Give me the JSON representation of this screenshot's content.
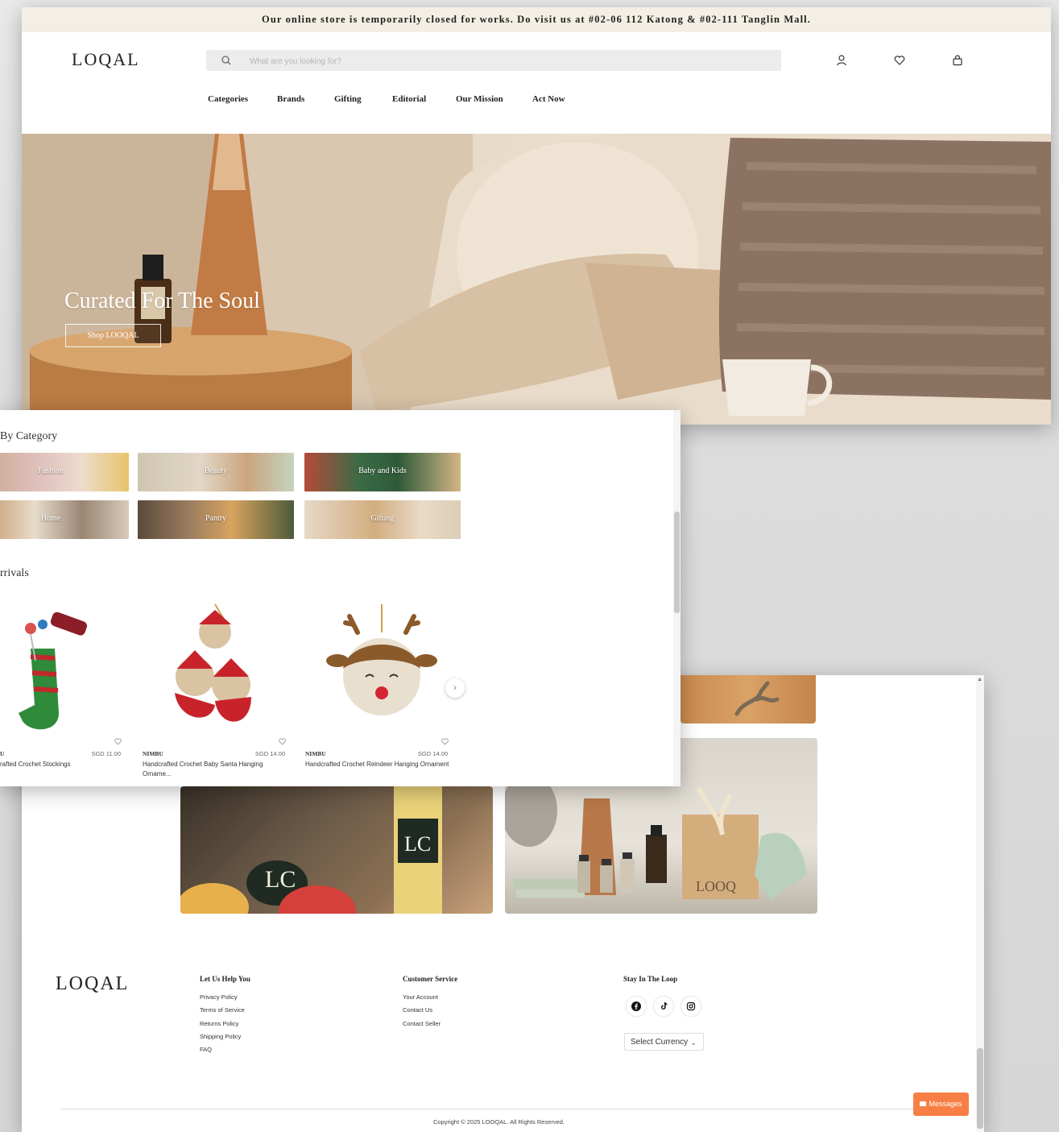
{
  "announcement": "Our online store is temporarily closed for works. Do visit us at #02-06 112 Katong & #02-111 Tanglin Mall.",
  "brand": {
    "logo_text": "LOQAL"
  },
  "search": {
    "placeholder": "What are you looking for?"
  },
  "header_icons": [
    "account-icon",
    "wishlist-heart-icon",
    "cart-bag-icon"
  ],
  "nav": {
    "items": [
      {
        "label": "Categories"
      },
      {
        "label": "Brands"
      },
      {
        "label": "Gifting"
      },
      {
        "label": "Editorial"
      },
      {
        "label": "Our Mission"
      },
      {
        "label": "Act Now"
      }
    ]
  },
  "hero": {
    "title": "Curated For The Soul",
    "button": "Shop LOOQAL"
  },
  "categories": {
    "title": "By Category",
    "tiles": [
      {
        "label": "Fashion"
      },
      {
        "label": "Beauty"
      },
      {
        "label": "Baby and Kids"
      },
      {
        "label": "Home"
      },
      {
        "label": "Pantry"
      },
      {
        "label": "Gifting"
      }
    ]
  },
  "new_arrivals": {
    "title": "rrivals",
    "products": [
      {
        "brand": "U",
        "price": "SGD 11.00",
        "name": "rafted Crochet Stockings"
      },
      {
        "brand": "NIMBU",
        "price": "SGD 14.00",
        "name": "Handcrafted Crochet Baby Santa Hanging Orname..."
      },
      {
        "brand": "NIMBU",
        "price": "SGD 14.00",
        "name": "Handcrafted Crochet Reindeer Hanging Ornament"
      }
    ]
  },
  "footer": {
    "logo_text": "LOQAL",
    "help": {
      "title": "Let Us Help You",
      "links": [
        "Privacy Policy",
        "Terms of Service",
        "Returns Policy",
        "Shipping Policy",
        "FAQ"
      ]
    },
    "service": {
      "title": "Customer Service",
      "links": [
        "Your Account",
        "Contact Us",
        "Contact Seller"
      ]
    },
    "loop": {
      "title": "Stay In The Loop",
      "social": [
        "facebook-icon",
        "tiktok-icon",
        "instagram-icon"
      ]
    },
    "currency": "Select Currency",
    "copyright": "Copyright © 2025 LOOQAL. All Rights Reserved.",
    "messages_button": "Messages"
  },
  "colors": {
    "announce_bg": "#f3efe4",
    "accent_orange": "#f77f45",
    "text_dark": "#222222"
  }
}
